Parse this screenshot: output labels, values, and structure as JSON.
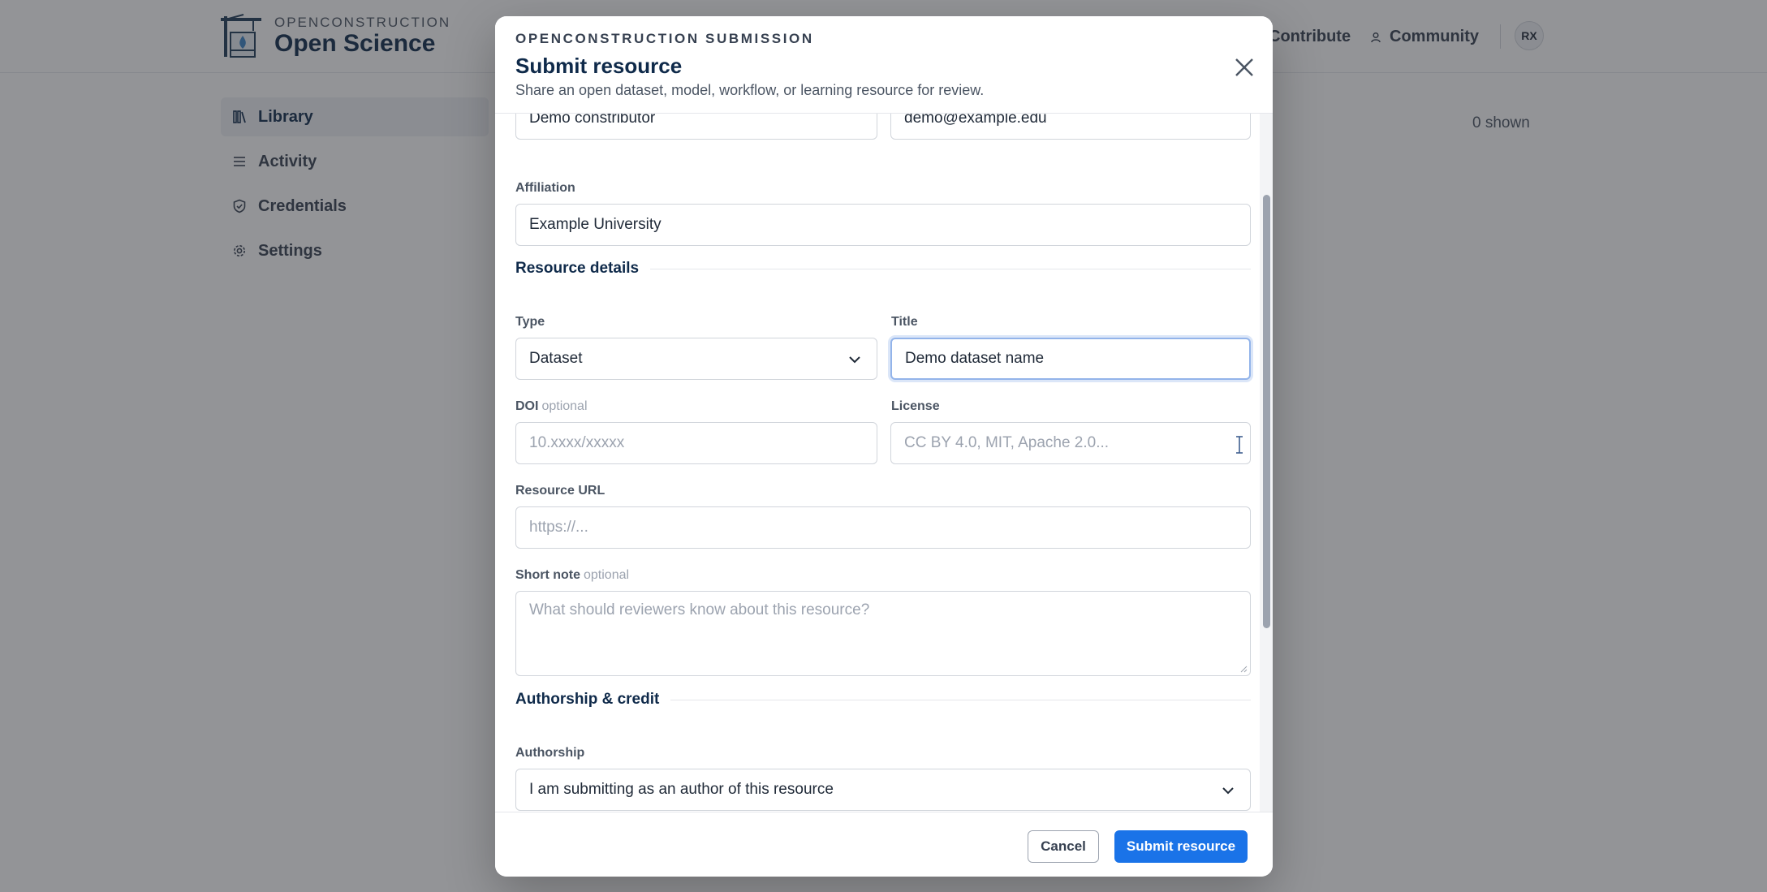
{
  "app": {
    "logo_sub": "OPENCONSTRUCTION",
    "logo_main": "Open Science",
    "nav": {
      "contribute": "Contribute",
      "community": "Community",
      "avatar_initials": "RX"
    },
    "sidebar": {
      "items": [
        {
          "label": "Library",
          "icon": "library-icon",
          "active": true
        },
        {
          "label": "Activity",
          "icon": "list-icon",
          "active": false
        },
        {
          "label": "Credentials",
          "icon": "shield-check-icon",
          "active": false
        },
        {
          "label": "Settings",
          "icon": "gear-icon",
          "active": false
        }
      ]
    },
    "shown_count": "0 shown"
  },
  "modal": {
    "eyebrow": "OPENCONSTRUCTION SUBMISSION",
    "title": "Submit resource",
    "description": "Share an open dataset, model, workflow, or learning resource for review.",
    "fields": {
      "name": {
        "value": "Demo constributor"
      },
      "email": {
        "value": "demo@example.edu"
      },
      "affiliation": {
        "label": "Affiliation",
        "value": "Example University"
      },
      "type": {
        "label": "Type",
        "value": "Dataset"
      },
      "title": {
        "label": "Title",
        "value": "Demo dataset name"
      },
      "doi": {
        "label": "DOI",
        "optional": "optional",
        "placeholder": "10.xxxx/xxxxx"
      },
      "license": {
        "label": "License",
        "placeholder": "CC BY 4.0, MIT, Apache 2.0..."
      },
      "resource_url": {
        "label": "Resource URL",
        "placeholder": "https://..."
      },
      "short_note": {
        "label": "Short note",
        "optional": "optional",
        "placeholder": "What should reviewers know about this resource?"
      },
      "authorship": {
        "label": "Authorship",
        "value": "I am submitting as an author of this resource"
      }
    },
    "sections": {
      "resource_details": "Resource details",
      "authorship_credit": "Authorship & credit"
    },
    "buttons": {
      "cancel": "Cancel",
      "submit": "Submit resource"
    }
  },
  "colors": {
    "primary": "#1a73e8",
    "heading": "#0f2a4a",
    "overlay": "rgba(40,42,48,0.5)"
  }
}
